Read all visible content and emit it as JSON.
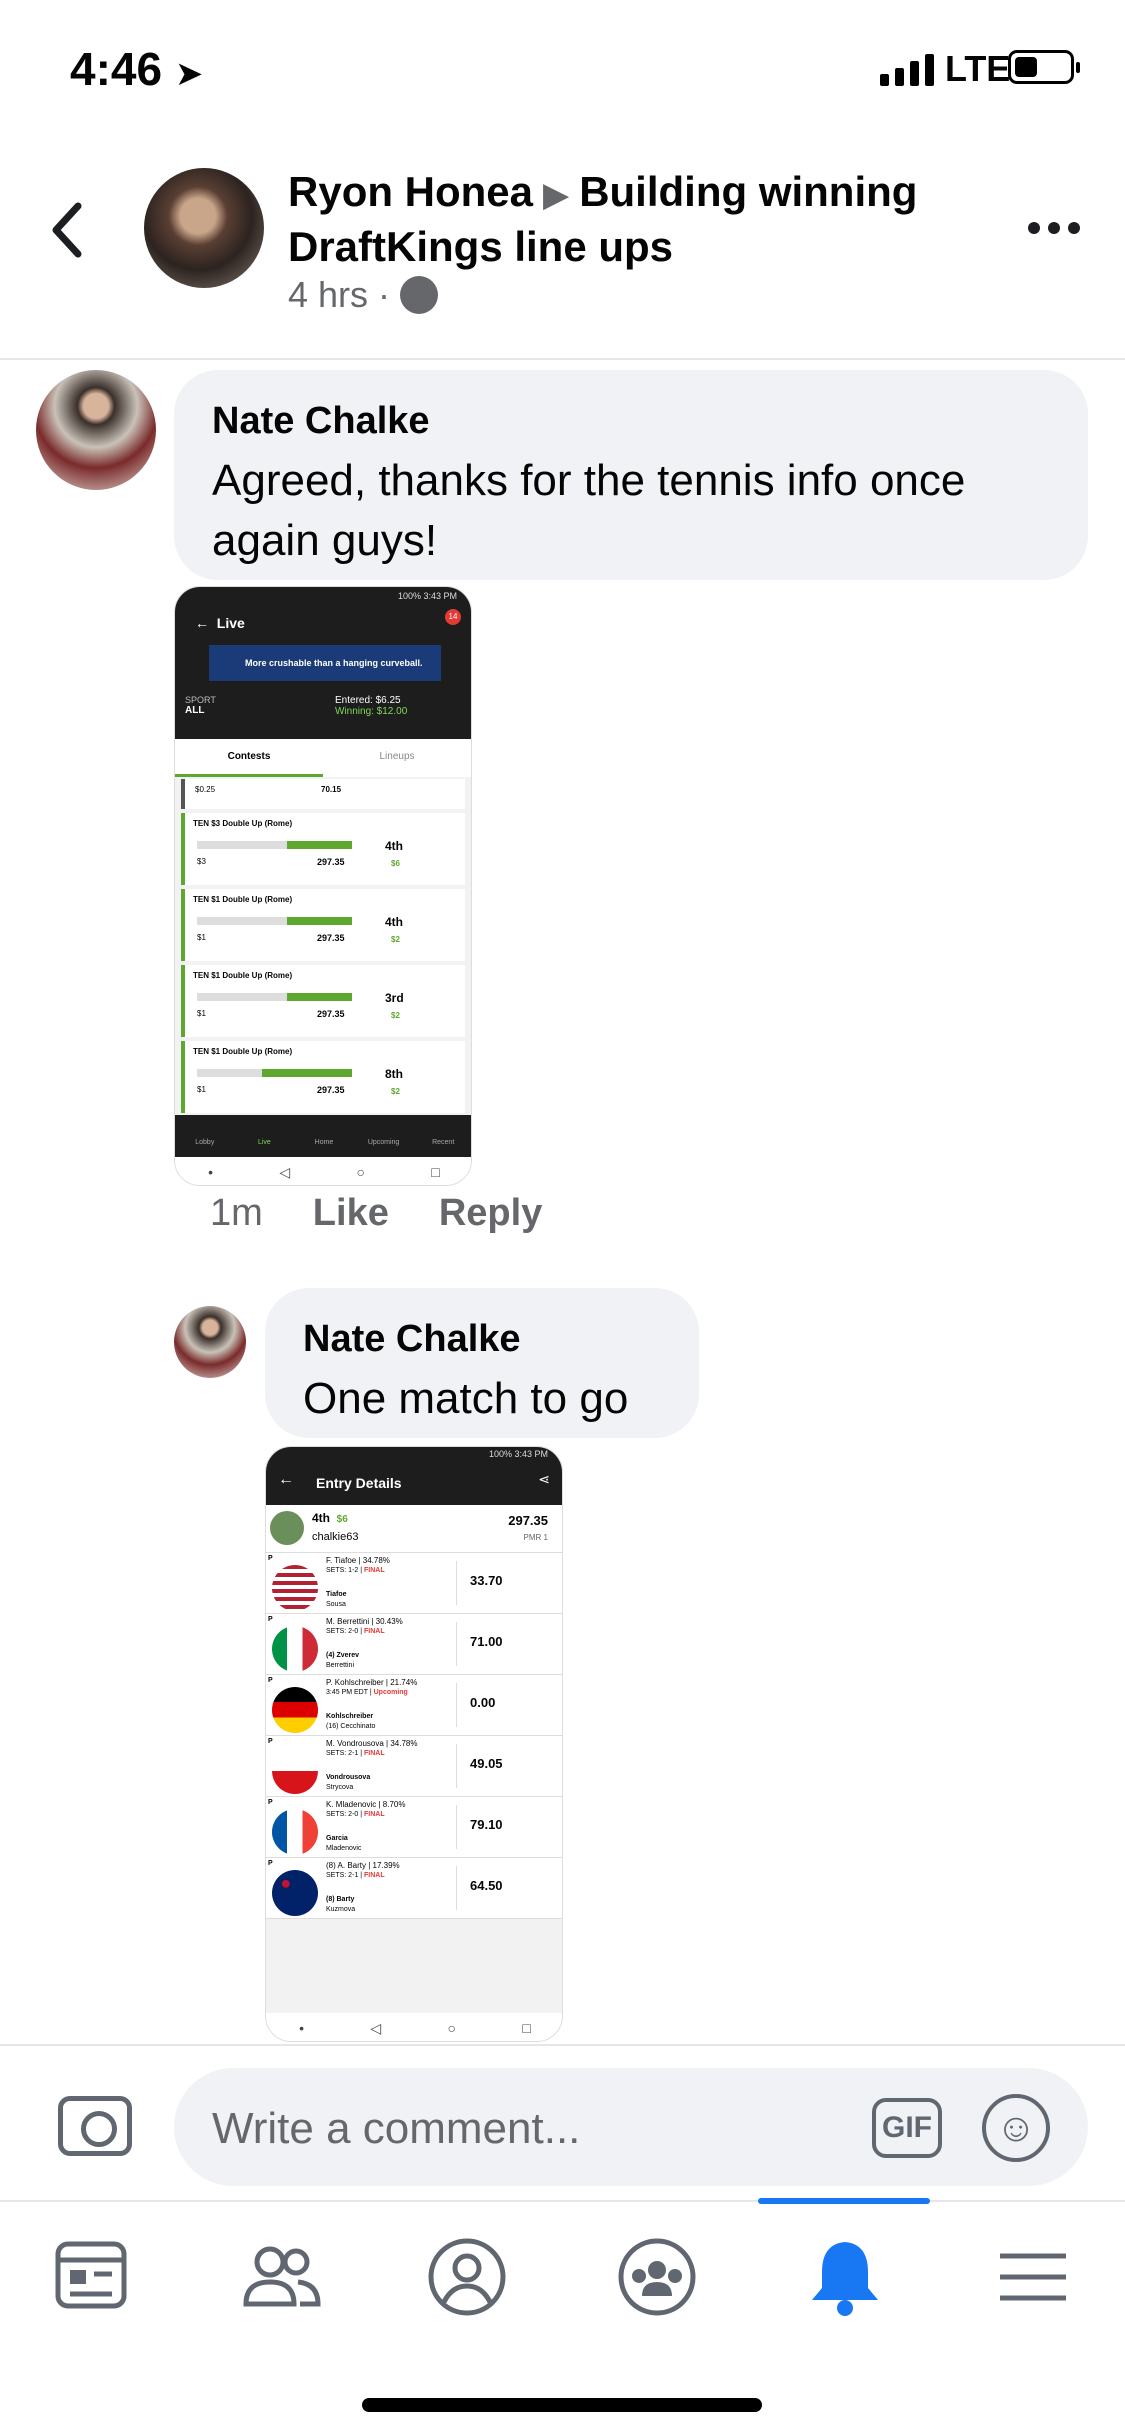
{
  "status_bar": {
    "time": "4:46",
    "network": "LTE"
  },
  "header": {
    "author": "Ryon Honea",
    "group": "Building winning DraftKings line ups",
    "meta": "4 hrs ·"
  },
  "comments": [
    {
      "name": "Nate Chalke",
      "text": "Agreed, thanks for the tennis info once again guys!",
      "time": "1m",
      "like": "Like",
      "reply": "Reply"
    },
    {
      "name": "Nate Chalke",
      "text": "One match to go"
    }
  ],
  "shot1": {
    "status": "100% 3:43 PM",
    "title": "Live",
    "badge": "14",
    "banner": "More crushable than a hanging curveball.",
    "sport_label": "SPORT",
    "sport_value": "ALL",
    "entered": "Entered: $6.25",
    "winning": "Winning: $12.00",
    "tab_contests": "Contests",
    "tab_lineups": "Lineups",
    "row0_fee": "$0.25",
    "row0_pts": "70.15",
    "cards": [
      {
        "title": "TEN $3 Double Up (Rome)",
        "fee": "$3",
        "pts": "297.35",
        "place": "4th",
        "win": "$6",
        "fill": 0.42
      },
      {
        "title": "TEN $1 Double Up (Rome)",
        "fee": "$1",
        "pts": "297.35",
        "place": "4th",
        "win": "$2",
        "fill": 0.42
      },
      {
        "title": "TEN $1 Double Up (Rome)",
        "fee": "$1",
        "pts": "297.35",
        "place": "3rd",
        "win": "$2",
        "fill": 0.42
      },
      {
        "title": "TEN $1 Double Up (Rome)",
        "fee": "$1",
        "pts": "297.35",
        "place": "8th",
        "win": "$2",
        "fill": 0.58
      }
    ],
    "nav": [
      "Lobby",
      "Live",
      "Home",
      "Upcoming",
      "Recent"
    ]
  },
  "shot2": {
    "status": "100% 3:43 PM",
    "title": "Entry Details",
    "place": "4th",
    "prize": "$6",
    "user": "chalkie63",
    "score": "297.35",
    "pmr": "PMR 1",
    "rows": [
      {
        "name": "F. Tiafoe | 34.78%",
        "sets": "SETS: 1-2 |",
        "status": "FINAL",
        "p1": "Tiafoe",
        "p2": "Sousa",
        "pts": "33.70",
        "flag": "usa"
      },
      {
        "name": "M. Berrettini | 30.43%",
        "sets": "SETS: 2-0 |",
        "status": "FINAL",
        "p1": "(4) Zverev",
        "p2": "Berrettini",
        "pts": "71.00",
        "flag": "ita"
      },
      {
        "name": "P. Kohlschreiber | 21.74%",
        "sets": "3:45 PM EDT |",
        "status": "Upcoming",
        "p1": "Kohlschreiber",
        "p2": "(16) Cecchinato",
        "pts": "0.00",
        "flag": "ger"
      },
      {
        "name": "M. Vondrousova | 34.78%",
        "sets": "SETS: 2-1 |",
        "status": "FINAL",
        "p1": "Vondrousova",
        "p2": "Strycova",
        "pts": "49.05",
        "flag": "cze"
      },
      {
        "name": "K. Mladenovic | 8.70%",
        "sets": "SETS: 2-0 |",
        "status": "FINAL",
        "p1": "Garcia",
        "p2": "Mladenovic",
        "pts": "79.10",
        "flag": "fra"
      },
      {
        "name": "(8) A. Barty | 17.39%",
        "sets": "SETS: 2-1 |",
        "status": "FINAL",
        "p1": "(8) Barty",
        "p2": "Kuzmova",
        "pts": "64.50",
        "flag": "aus"
      }
    ]
  },
  "composer": {
    "placeholder": "Write a comment...",
    "gif": "GIF"
  },
  "tabs": [
    "news-feed",
    "friends",
    "profile",
    "groups",
    "notifications",
    "menu"
  ],
  "colors": {
    "accent": "#1877f2",
    "bubble": "#f0f2f5",
    "dk_green": "#5fa82f"
  }
}
